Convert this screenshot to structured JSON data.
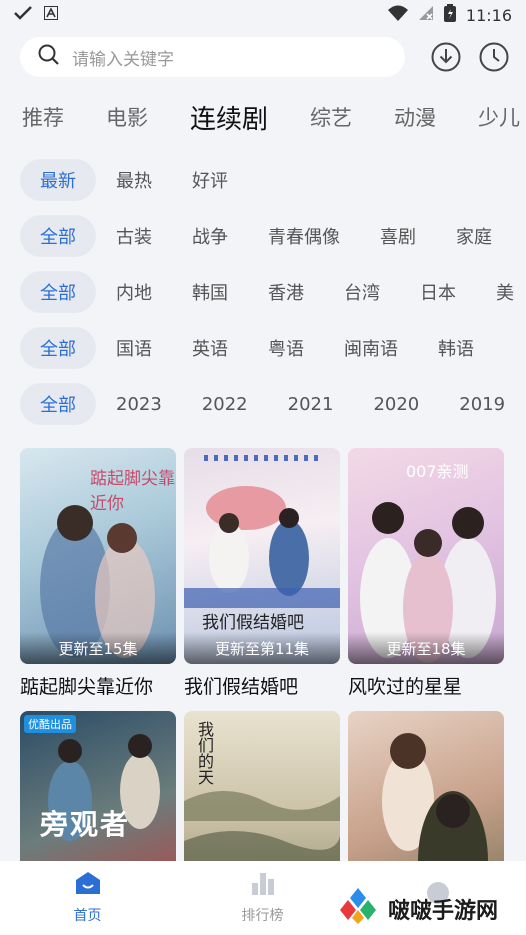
{
  "status_bar": {
    "time": "11:16"
  },
  "search": {
    "placeholder": "请输入关键字"
  },
  "tabs": [
    "推荐",
    "电影",
    "连续剧",
    "综艺",
    "动漫",
    "少儿"
  ],
  "active_tab": "连续剧",
  "filters": {
    "sort": [
      "最新",
      "最热",
      "好评"
    ],
    "genre": [
      "全部",
      "古装",
      "战争",
      "青春偶像",
      "喜剧",
      "家庭"
    ],
    "region": [
      "全部",
      "内地",
      "韩国",
      "香港",
      "台湾",
      "日本",
      "美"
    ],
    "language": [
      "全部",
      "国语",
      "英语",
      "粤语",
      "闽南语",
      "韩语"
    ],
    "year": [
      "全部",
      "2023",
      "2022",
      "2021",
      "2020",
      "2019"
    ]
  },
  "cards": [
    {
      "title": "踮起脚尖靠近你",
      "badge": "更新至15集"
    },
    {
      "title": "我们假结婚吧",
      "badge": "更新至第11集"
    },
    {
      "title": "风吹过的星星",
      "badge": "更新至18集"
    },
    {
      "title": "",
      "badge": ""
    },
    {
      "title": "",
      "badge": ""
    },
    {
      "title": "",
      "badge": ""
    }
  ],
  "poster_text": {
    "p1": "踮起脚尖靠近你",
    "p2": "我们假结婚吧",
    "p3": "007亲测",
    "p4a": "优酷出品",
    "p4b": "旁观者",
    "p5": "我们的天"
  },
  "bottom_nav": [
    {
      "label": "首页",
      "icon": "home-icon"
    },
    {
      "label": "排行榜",
      "icon": "rank-icon"
    },
    {
      "label": "",
      "icon": "mine-icon"
    }
  ],
  "watermark": "啵啵手游网",
  "colors": {
    "accent": "#2b6fd6",
    "chip_bg": "#e6e9f0",
    "background": "#f2f4f8"
  }
}
